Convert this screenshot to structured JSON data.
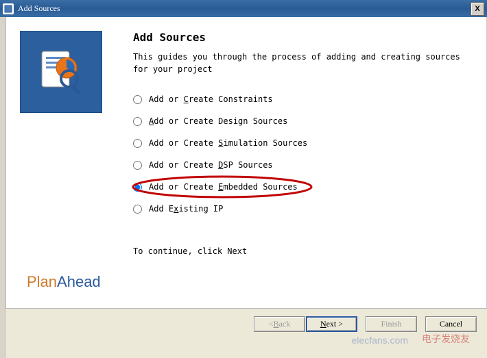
{
  "titlebar": {
    "title": "Add Sources",
    "close": "X"
  },
  "page": {
    "heading": "Add Sources",
    "subtext": "This guides you through the process of adding and creating sources for your project"
  },
  "radios": [
    {
      "label_pre": "Add or ",
      "hot": "C",
      "label_post": "reate Constraints",
      "selected": false
    },
    {
      "label_pre": "",
      "hot": "A",
      "label_post": "dd or Create Design Sources",
      "selected": false
    },
    {
      "label_pre": "Add or Create ",
      "hot": "S",
      "label_post": "imulation Sources",
      "selected": false
    },
    {
      "label_pre": "Add or Create ",
      "hot": "D",
      "label_post": "SP Sources",
      "selected": false
    },
    {
      "label_pre": "Add or Create ",
      "hot": "E",
      "label_post": "mbedded Sources",
      "selected": true
    },
    {
      "label_pre": "Add E",
      "hot": "x",
      "label_post": "isting IP",
      "selected": false
    }
  ],
  "continue": "To continue, click Next",
  "brand": {
    "a": "Plan",
    "b": "Ahead"
  },
  "buttons": {
    "back": "< Back",
    "next": "Next >",
    "finish": "Finish",
    "cancel": "Cancel"
  },
  "watermark_a": "elecfans.com",
  "watermark_b": "电子发烧友"
}
